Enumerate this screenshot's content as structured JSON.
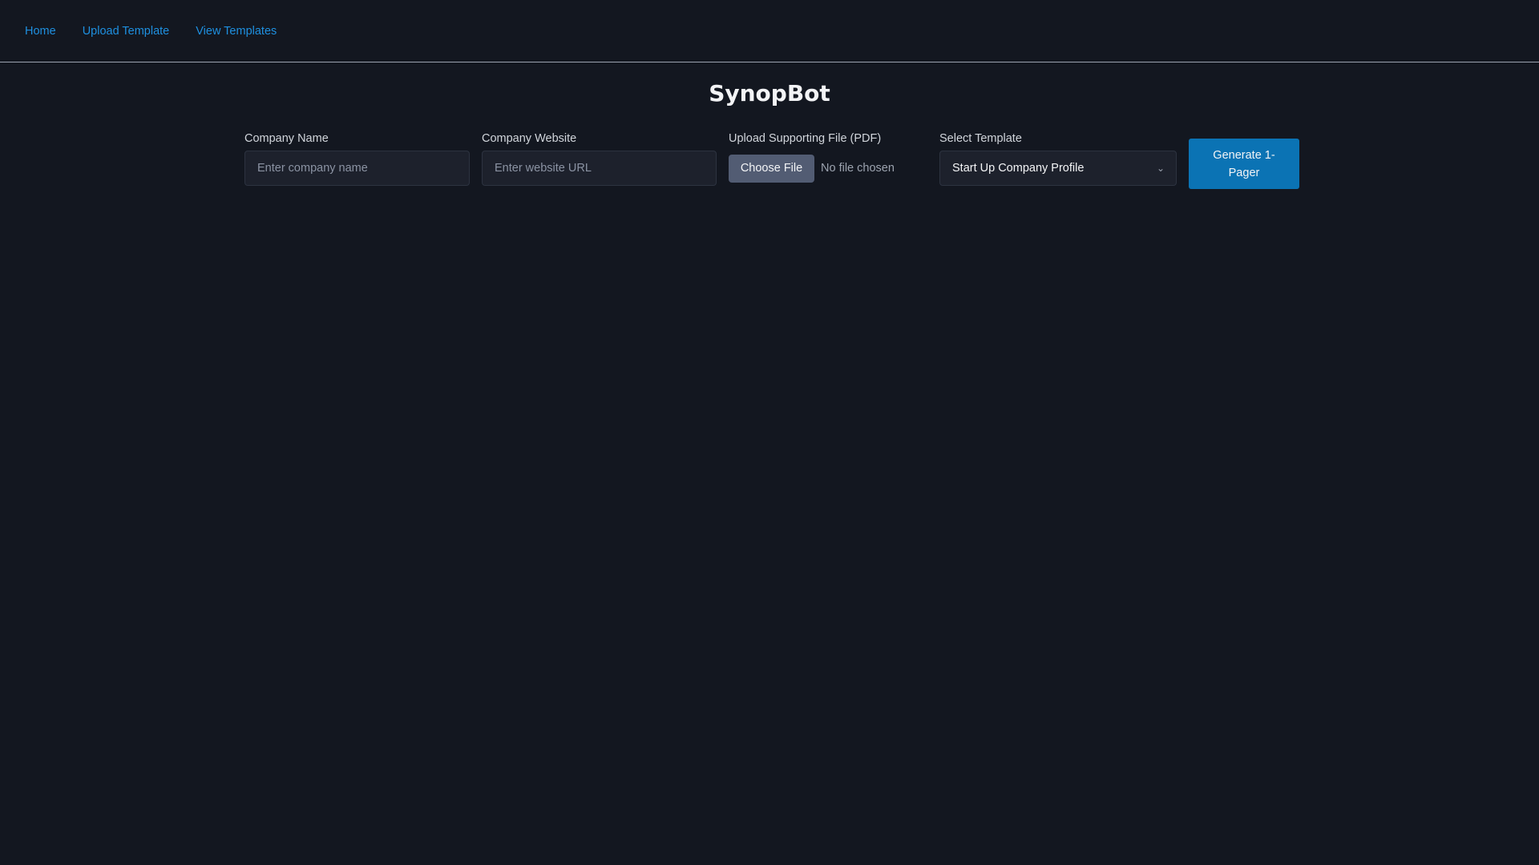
{
  "nav": {
    "links": [
      {
        "label": "Home"
      },
      {
        "label": "Upload Template"
      },
      {
        "label": "View Templates"
      }
    ]
  },
  "header": {
    "title": "SynopBot"
  },
  "form": {
    "company_name": {
      "label": "Company Name",
      "placeholder": "Enter company name",
      "value": ""
    },
    "company_website": {
      "label": "Company Website",
      "placeholder": "Enter website URL",
      "value": ""
    },
    "upload": {
      "label": "Upload Supporting File (PDF)",
      "button_label": "Choose File",
      "status": "No file chosen"
    },
    "template": {
      "label": "Select Template",
      "selected": "Start Up Company Profile",
      "chevron_icon": "chevron-down-icon"
    },
    "submit_label": "Generate 1-Pager"
  },
  "colors": {
    "background": "#131720",
    "link": "#1e90e0",
    "primary_button": "#0b73b4",
    "file_button": "#525c73"
  }
}
